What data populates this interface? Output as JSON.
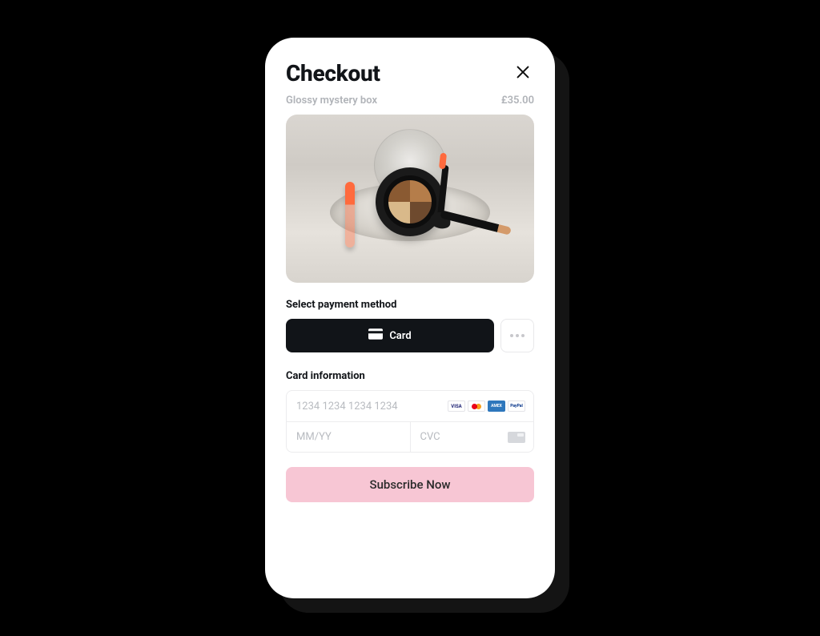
{
  "header": {
    "title": "Checkout"
  },
  "product": {
    "name": "Glossy mystery box",
    "price": "£35.00"
  },
  "payment": {
    "select_label": "Select payment method",
    "card_label": "Card"
  },
  "card_info": {
    "label": "Card information",
    "number_placeholder": "1234 1234 1234 1234",
    "expiry_placeholder": "MM/YY",
    "cvc_placeholder": "CVC",
    "brands": {
      "visa": "VISA",
      "mc": "",
      "amex": "AMEX",
      "paypal": "PayPal"
    }
  },
  "cta": {
    "subscribe": "Subscribe Now"
  }
}
